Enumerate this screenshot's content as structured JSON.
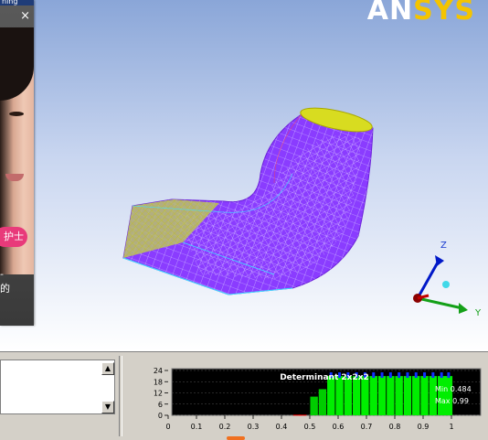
{
  "brand": {
    "part1": "AN",
    "part2": "SYS",
    "colors": {
      "part1": "#ffffff",
      "part2": "#f4c400"
    }
  },
  "popup": {
    "header_text": "ning",
    "close_icon": "close-icon",
    "badge": "护士",
    "text_lines": [
      "-",
      "的"
    ]
  },
  "triad": {
    "z": "Z",
    "y": "Y"
  },
  "listbox": {
    "scroll_up": "▲",
    "scroll_down": "▼"
  },
  "chart_data": {
    "type": "bar",
    "title": "Determinant 2x2x2",
    "stats": {
      "min_label": "Min",
      "min_value": "0.484",
      "max_label": "Max",
      "max_value": "0.99"
    },
    "xlim": [
      0,
      1
    ],
    "ylim": [
      0,
      24
    ],
    "x_ticks": [
      "0",
      "0.1",
      "0.2",
      "0.3",
      "0.4",
      "0.5",
      "0.6",
      "0.7",
      "0.8",
      "0.9",
      "1"
    ],
    "y_ticks": [
      "0",
      "6",
      "12",
      "18",
      "24"
    ],
    "bins": [
      {
        "x": 0.455,
        "value": 0.3,
        "color": "#ff0000"
      },
      {
        "x": 0.475,
        "value": 0.3,
        "color": "#ff0000"
      },
      {
        "x": 0.515,
        "value": 10,
        "color": "#00cc00"
      },
      {
        "x": 0.545,
        "value": 14,
        "color": "#00cc00"
      },
      {
        "x": 0.575,
        "value": 21,
        "color": "#00ee00"
      },
      {
        "x": 0.605,
        "value": 21,
        "color": "#00ee00"
      },
      {
        "x": 0.635,
        "value": 21,
        "color": "#00ee00"
      },
      {
        "x": 0.665,
        "value": 21,
        "color": "#00ee00"
      },
      {
        "x": 0.695,
        "value": 21,
        "color": "#00ee00"
      },
      {
        "x": 0.725,
        "value": 21,
        "color": "#00ee00"
      },
      {
        "x": 0.755,
        "value": 21,
        "color": "#00ee00"
      },
      {
        "x": 0.785,
        "value": 21,
        "color": "#00ee00"
      },
      {
        "x": 0.815,
        "value": 21,
        "color": "#00ee00"
      },
      {
        "x": 0.845,
        "value": 21,
        "color": "#00ee00"
      },
      {
        "x": 0.875,
        "value": 21,
        "color": "#00ee00"
      },
      {
        "x": 0.905,
        "value": 21,
        "color": "#00ee00"
      },
      {
        "x": 0.935,
        "value": 21,
        "color": "#00ee00"
      },
      {
        "x": 0.965,
        "value": 21,
        "color": "#00ee00"
      },
      {
        "x": 0.99,
        "value": 21,
        "color": "#00ee00"
      }
    ],
    "marker_color": "#1030ff",
    "background": "#000000"
  }
}
